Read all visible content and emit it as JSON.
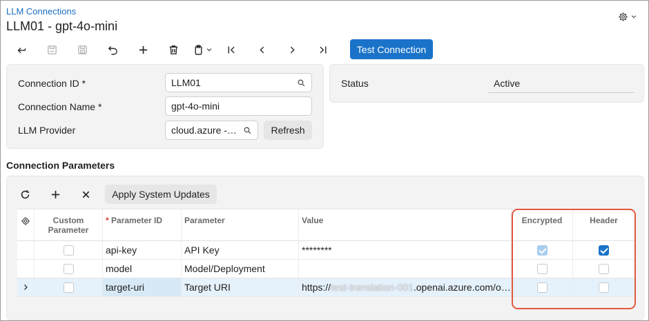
{
  "header": {
    "breadcrumb": "LLM Connections",
    "title": "LLM01 - gpt-4o-mini"
  },
  "toolbar": {
    "test_connection_label": "Test Connection"
  },
  "form": {
    "connection_id_label": "Connection ID",
    "connection_id_value": "LLM01",
    "connection_name_label": "Connection Name",
    "connection_name_value": "gpt-4o-mini",
    "llm_provider_label": "LLM Provider",
    "llm_provider_value": "cloud.azure -…",
    "refresh_label": "Refresh",
    "required_mark": "*"
  },
  "status": {
    "label": "Status",
    "value": "Active"
  },
  "parameters": {
    "section_title": "Connection Parameters",
    "apply_label": "Apply System Updates",
    "columns": {
      "custom": "Custom Parameter",
      "parameter_id": "Parameter ID",
      "parameter": "Parameter",
      "value": "Value",
      "encrypted": "Encrypted",
      "header": "Header"
    },
    "rows": [
      {
        "parameter_id": "api-key",
        "parameter": "API Key",
        "value": "********",
        "custom": false,
        "encrypted": true,
        "header": true
      },
      {
        "parameter_id": "model",
        "parameter": "Model/Deployment",
        "value": "",
        "custom": false,
        "encrypted": false,
        "header": false
      },
      {
        "parameter_id": "target-uri",
        "parameter": "Target URI",
        "value_prefix": "https://",
        "value_blurred": "test-translation-001",
        "value_suffix": ".openai.azure.com/o…",
        "custom": false,
        "encrypted": false,
        "header": false
      }
    ]
  },
  "icons": [
    "back-icon",
    "save-draft-icon",
    "save-icon",
    "undo-icon",
    "add-icon",
    "delete-icon",
    "copy-paste-icon",
    "first-icon",
    "previous-icon",
    "next-icon",
    "last-icon",
    "gear-icon",
    "search-icon",
    "refresh-icon",
    "close-icon",
    "chevron-right-icon"
  ],
  "colors": {
    "accent": "#1a73c8",
    "highlight_box": "#e2573f",
    "selected_row": "#e5f1fb"
  }
}
